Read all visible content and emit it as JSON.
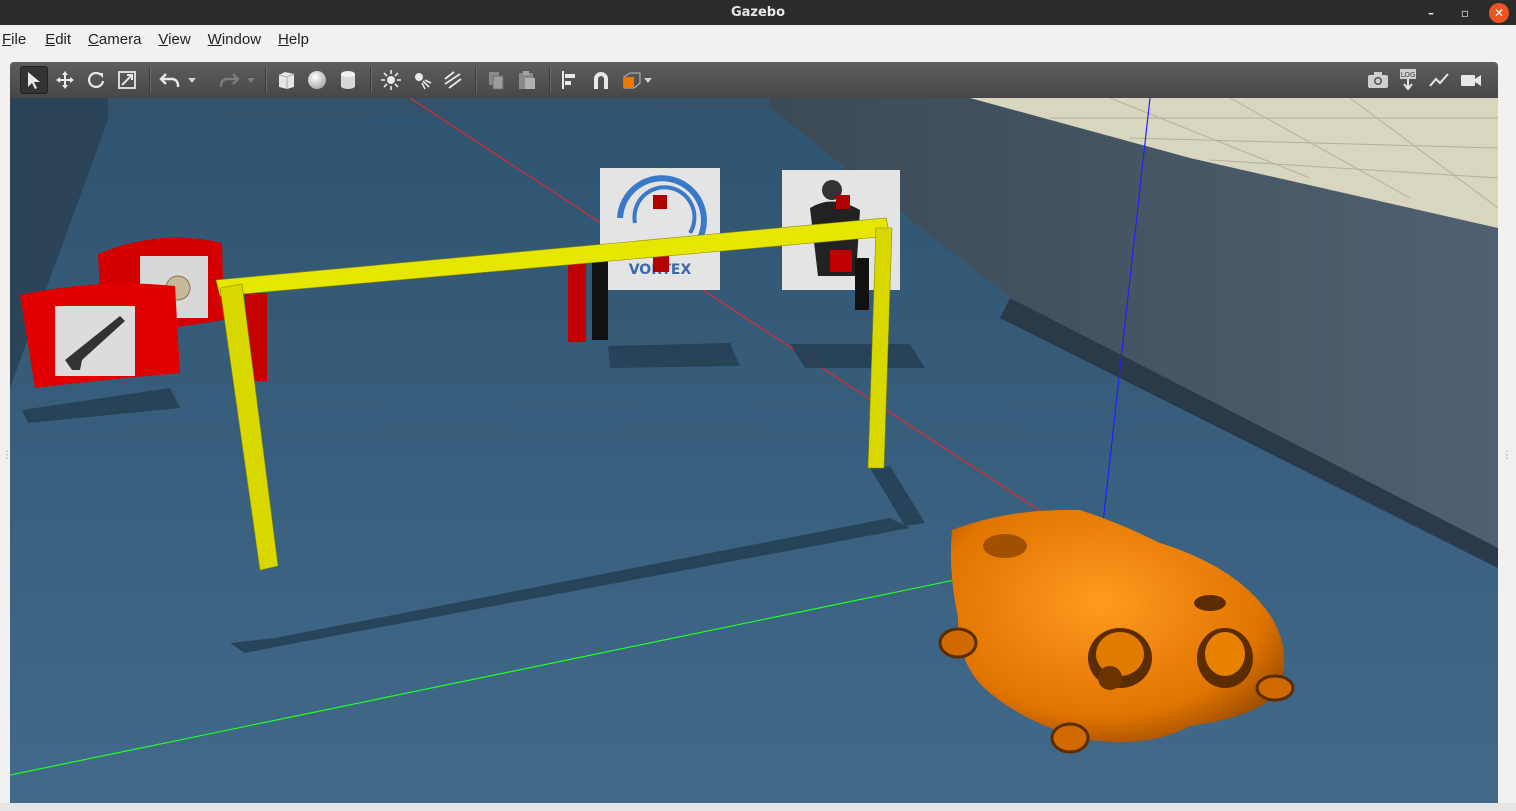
{
  "window": {
    "title": "Gazebo",
    "minimize": "–",
    "maximize": "▫",
    "close": "✕"
  },
  "menu": [
    {
      "key": "F",
      "rest": "ile"
    },
    {
      "key": "E",
      "rest": "dit"
    },
    {
      "key": "C",
      "rest": "amera"
    },
    {
      "key": "V",
      "rest": "iew"
    },
    {
      "key": "W",
      "rest": "indow"
    },
    {
      "key": "H",
      "rest": "elp"
    }
  ],
  "toolbar": {
    "left_icons": [
      "select-arrow-icon",
      "translate-icon",
      "rotate-icon",
      "scale-icon",
      "undo-icon",
      "redo-icon",
      "box-shape-icon",
      "sphere-shape-icon",
      "cylinder-shape-icon",
      "point-light-icon",
      "spot-light-icon",
      "directional-light-icon",
      "copy-icon",
      "paste-icon",
      "align-icon",
      "snap-icon",
      "view-angle-icon"
    ],
    "right_icons": [
      "screenshot-icon",
      "log-icon",
      "plot-icon",
      "video-record-icon"
    ],
    "log_label": "LOG"
  },
  "scene": {
    "target_logo_text": "VORTEX",
    "colors": {
      "floor": "#3b6380",
      "gate": "#e0e000",
      "vehicle": "#f07800",
      "marker": "#cc0000"
    }
  }
}
